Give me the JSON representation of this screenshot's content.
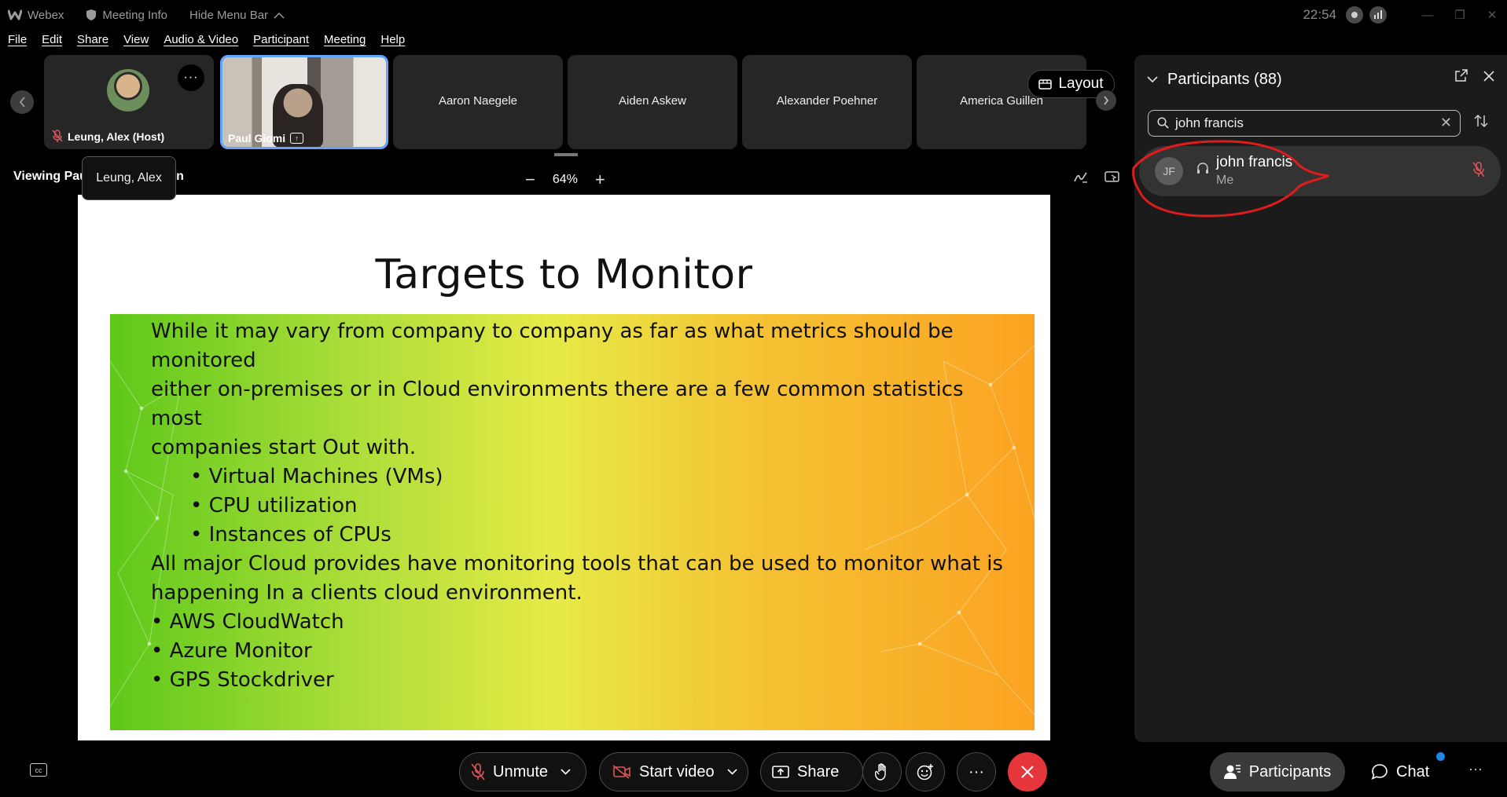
{
  "titlebar": {
    "app_name": "Webex",
    "meeting_info": "Meeting Info",
    "hide_menu": "Hide Menu Bar",
    "clock": "22:54"
  },
  "menu": [
    "File",
    "Edit",
    "Share",
    "View",
    "Audio & Video",
    "Participant",
    "Meeting",
    "Help"
  ],
  "strip": {
    "tiles": [
      {
        "name": "Leung, Alex (Host)"
      },
      {
        "name": "Paul Giomi"
      },
      {
        "name": "Aaron Naegele"
      },
      {
        "name": "Aiden Askew"
      },
      {
        "name": "Alexander Poehner"
      },
      {
        "name": "America Guillen"
      }
    ],
    "layout_label": "Layout"
  },
  "viewbar": {
    "viewing_text": "Viewing Paul Giomi's screen",
    "tooltip": "Leung, Alex",
    "zoom": "64%",
    "zoom_minus": "−",
    "zoom_plus": "+"
  },
  "slide": {
    "title": "Targets to Monitor",
    "lines": [
      {
        "text": "While it may vary from company to company as far as what metrics should be",
        "cls": ""
      },
      {
        "text": "monitored",
        "cls": ""
      },
      {
        "text": "either on-premises or in Cloud environments there are a few common statistics",
        "cls": ""
      },
      {
        "text": "most",
        "cls": ""
      },
      {
        "text": "companies start Out with.",
        "cls": ""
      },
      {
        "text": "•  Virtual Machines (VMs)",
        "cls": "ind"
      },
      {
        "text": "•  CPU utilization",
        "cls": "ind"
      },
      {
        "text": "•  Instances of CPUs",
        "cls": "ind"
      },
      {
        "text": " ",
        "cls": ""
      },
      {
        "text": "All major Cloud provides have monitoring tools that can be used to monitor what is",
        "cls": ""
      },
      {
        "text": "happening In a clients cloud environment.",
        "cls": ""
      },
      {
        "text": "•  AWS CloudWatch",
        "cls": ""
      },
      {
        "text": "•  Azure Monitor",
        "cls": ""
      },
      {
        "text": "•  GPS Stockdriver",
        "cls": ""
      }
    ]
  },
  "panel": {
    "title": "Participants (88)",
    "search_value": "john francis",
    "result": {
      "initials": "JF",
      "name": "john francis",
      "subtitle": "Me"
    }
  },
  "controls": {
    "unmute": "Unmute",
    "start_video": "Start video",
    "share": "Share",
    "more": "···",
    "participants": "Participants",
    "chat": "Chat",
    "overflow": "···"
  },
  "colors": {
    "accent_blue": "#63a4ff",
    "end_red": "#e5363b",
    "mute_red": "#e0565b",
    "annotation_red": "#e01b1b"
  }
}
